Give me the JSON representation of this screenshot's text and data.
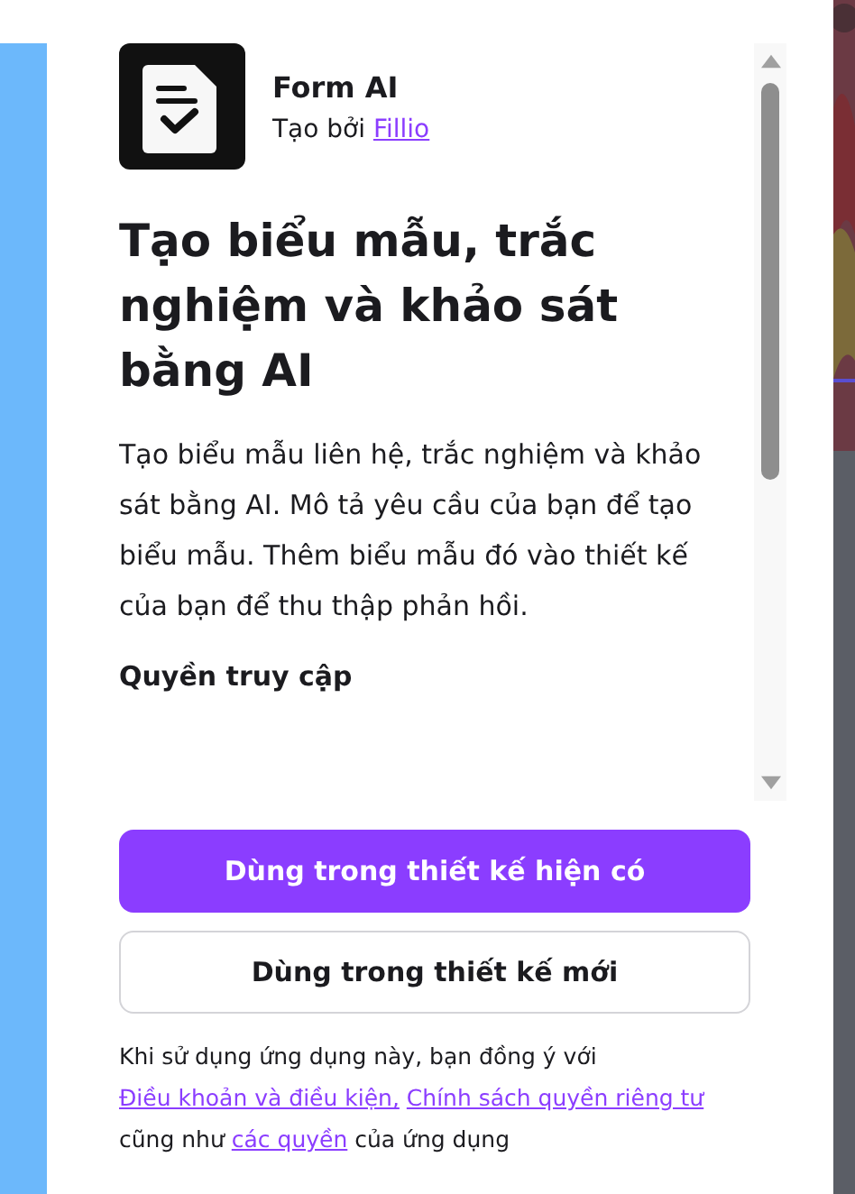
{
  "app": {
    "name": "Form AI",
    "byline": "Tạo bởi",
    "author": "Fillio"
  },
  "heading": "Tạo biểu mẫu, trắc nghiệm và khảo sát bằng AI",
  "description": "Tạo biểu mẫu liên hệ, trắc nghiệm và khảo sát bằng AI. Mô tả yêu cầu của bạn để tạo biểu mẫu. Thêm biểu mẫu đó vào thiết kế của bạn để thu thập phản hồi.",
  "section_title": "Quyền truy cập",
  "buttons": [
    {
      "label": "Dùng trong thiết kế hiện có",
      "kind": "primary"
    },
    {
      "label": "Dùng trong thiết kế mới",
      "kind": "secondary"
    }
  ],
  "disclaimer": [
    {
      "text": "Khi sử dụng ứng dụng này, bạn đồng ý với",
      "kind": "text"
    },
    {
      "text": "Điều khoản và điều kiện,",
      "kind": "link"
    },
    {
      "text": "Chính sách quyền riêng tư",
      "kind": "link"
    },
    {
      "text": "cũng như",
      "kind": "text"
    },
    {
      "text": "các quyền",
      "kind": "link"
    },
    {
      "text": "của ứng dụng",
      "kind": "text"
    }
  ]
}
